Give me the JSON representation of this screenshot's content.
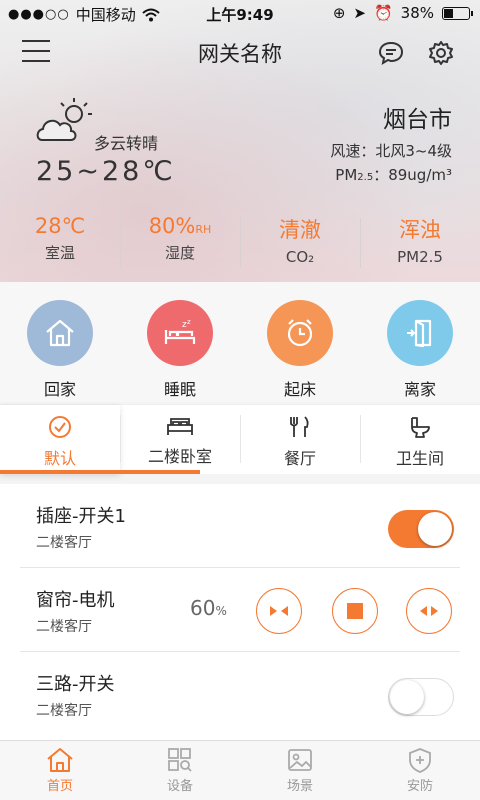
{
  "statusbar": {
    "carrier": "中国移动",
    "time": "上午9:49",
    "battery": "38%",
    "battery_level": 0.38
  },
  "header": {
    "title": "网关名称"
  },
  "weather": {
    "description": "多云转晴",
    "temp_range": "25~28℃",
    "city": "烟台市",
    "wind": "风速：北风3~4级",
    "pm25_label": "PM",
    "pm25_sub": "2.5",
    "pm25_value": "：89ug/m³"
  },
  "stats": [
    {
      "value": "28℃",
      "unit": "",
      "label": "室温"
    },
    {
      "value": "80%",
      "unit": "RH",
      "label": "湿度"
    },
    {
      "value": "清澈",
      "unit": "",
      "label": "CO₂"
    },
    {
      "value": "浑浊",
      "unit": "",
      "label": "PM2.5"
    }
  ],
  "scenes": [
    {
      "label": "回家",
      "color": "#9fb9d9"
    },
    {
      "label": "睡眠",
      "color": "#ef6a6c"
    },
    {
      "label": "起床",
      "color": "#f59556"
    },
    {
      "label": "离家",
      "color": "#7fcaeb"
    }
  ],
  "tabs": [
    {
      "label": "默认",
      "active": true
    },
    {
      "label": "二楼卧室",
      "active": false
    },
    {
      "label": "餐厅",
      "active": false
    },
    {
      "label": "卫生间",
      "active": false
    }
  ],
  "devices": [
    {
      "name": "插座-开关1",
      "room": "二楼客厅",
      "state": "on"
    },
    {
      "name": "窗帘-电机",
      "room": "二楼客厅",
      "percent": "60",
      "percent_unit": "%"
    },
    {
      "name": "三路-开关",
      "room": "二楼客厅",
      "state": "off"
    }
  ],
  "bottom_nav": [
    {
      "label": "首页",
      "active": true
    },
    {
      "label": "设备",
      "active": false
    },
    {
      "label": "场景",
      "active": false
    },
    {
      "label": "安防",
      "active": false
    }
  ],
  "colors": {
    "accent": "#f47a32"
  }
}
